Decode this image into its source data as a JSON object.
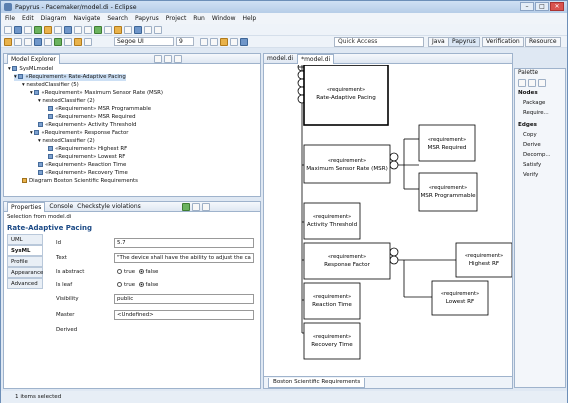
{
  "window": {
    "title": "Papyrus - Pacemaker/model.di - Eclipse"
  },
  "menu": [
    "File",
    "Edit",
    "Diagram",
    "Navigate",
    "Search",
    "Papyrus",
    "Project",
    "Run",
    "Window",
    "Help"
  ],
  "toolbar": {
    "font_name": "Segoe UI",
    "font_size": "9",
    "quick_access": "Quick Access",
    "perspectives": [
      "Java",
      "Papyrus",
      "Verification",
      "Resource"
    ]
  },
  "explorer": {
    "tab": "Model Explorer",
    "items": [
      "SysMLmodel",
      "«Requirement» Rate-Adaptive Pacing",
      "nestedClassifier (5)",
      "«Requirement» Maximum Sensor Rate (MSR)",
      "nestedClassifier (2)",
      "«Requirement» MSR Programmable",
      "«Requirement» MSR Required",
      "«Requirement» Activity Threshold",
      "«Requirement» Response Factor",
      "nestedClassifier (2)",
      "«Requirement» Highest RF",
      "«Requirement» Lowest RF",
      "«Requirement» Reaction Time",
      "«Requirement» Recovery Time",
      "Diagram Boston Scientific Requirements"
    ]
  },
  "properties": {
    "tabs": [
      "Properties",
      "Console",
      "Checkstyle violations"
    ],
    "selection": "Selection from model.di",
    "title": "Rate-Adaptive Pacing",
    "sections": [
      "UML",
      "SysML",
      "Profile",
      "Appearance",
      "Advanced"
    ],
    "fields": {
      "id_label": "Id",
      "id_value": "5.7",
      "text_label": "Text",
      "text_value": "\"The device shall have the ability to adjust the cardiac",
      "abstract_label": "Is abstract",
      "leaf_label": "Is leaf",
      "true_label": "true",
      "false_label": "false",
      "visibility_label": "Visibility",
      "visibility_value": "public",
      "master_label": "Master",
      "master_value": "<Undefined>",
      "derived_label": "Derived"
    }
  },
  "editor": {
    "tabs": [
      "model.di",
      "*model.di"
    ],
    "diagram_tab": "Boston Scientific Requirements",
    "stereotype": "«requirement»",
    "nodes": {
      "rap": "Rate-Adaptive Pacing",
      "msr": "Maximum Sensor Rate (MSR)",
      "msrreq": "MSR Required",
      "msrprog": "MSR Programmable",
      "act": "Activity Threshold",
      "resp": "Response Factor",
      "high": "Highest RF",
      "low": "Lowest RF",
      "react": "Reaction Time",
      "recov": "Recovery Time"
    }
  },
  "palette": {
    "title": "Palette",
    "nodes_header": "Nodes",
    "nodes": [
      "Package",
      "Require..."
    ],
    "edges_header": "Edges",
    "edges": [
      "Copy",
      "Derive",
      "Decomp...",
      "Satisfy",
      "Verify"
    ]
  },
  "status": "1 items selected"
}
